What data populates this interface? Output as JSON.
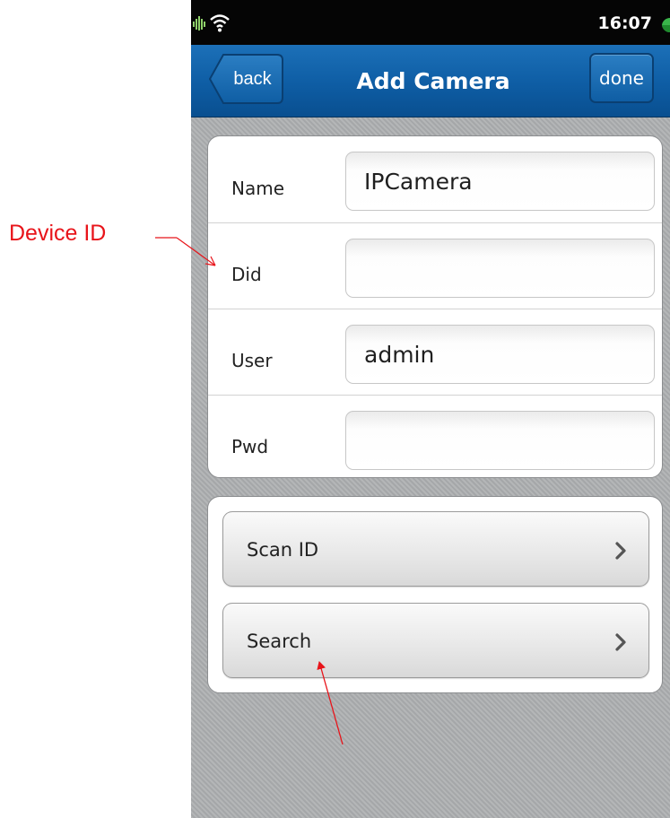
{
  "annotation": {
    "callout_label": "Device ID",
    "callout_color": "#e8141a"
  },
  "status_bar": {
    "time": "16:07",
    "icons": [
      "signal-icon",
      "wifi-icon",
      "battery-icon"
    ]
  },
  "nav": {
    "back_label": "back",
    "title": "Add Camera",
    "done_label": "done",
    "accent": "#0e5da4"
  },
  "form": {
    "fields": [
      {
        "label": "Name",
        "value": "IPCamera"
      },
      {
        "label": "Did",
        "value": ""
      },
      {
        "label": "User",
        "value": "admin"
      },
      {
        "label": "Pwd",
        "value": ""
      }
    ]
  },
  "actions": [
    {
      "label": "Scan ID",
      "icon": "chevron-right-icon"
    },
    {
      "label": "Search",
      "icon": "chevron-right-icon"
    }
  ]
}
